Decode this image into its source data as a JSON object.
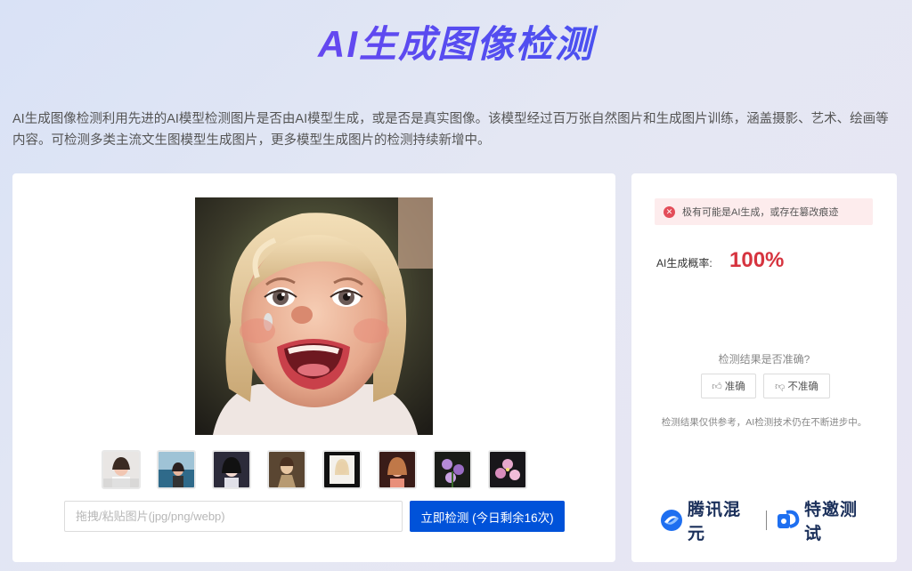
{
  "header": {
    "title": "AI生成图像检测",
    "description": "AI生成图像检测利用先进的AI模型检测图片是否由AI模型生成，或是否是真实图像。该模型经过百万张自然图片和生成图片训练，涵盖摄影、艺术、绘画等内容。可检测多类主流文生图模型生成图片，更多模型生成图片的检测持续新增中。"
  },
  "upload": {
    "placeholder": "拖拽/粘贴图片(jpg/png/webp)",
    "button_label": "立即检测 (今日剩余16次)"
  },
  "thumbnails": [
    {
      "name": "thumb-woman-portrait"
    },
    {
      "name": "thumb-woman-outdoor"
    },
    {
      "name": "thumb-anime-girl"
    },
    {
      "name": "thumb-vintage-portrait"
    },
    {
      "name": "thumb-blonde-woman"
    },
    {
      "name": "thumb-woman-warm"
    },
    {
      "name": "thumb-purple-flowers"
    },
    {
      "name": "thumb-pink-flowers"
    }
  ],
  "result": {
    "alert_text": "极有可能是AI生成，或存在篡改痕迹",
    "probability_label": "AI生成概率:",
    "probability_value": "100%",
    "feedback_question": "检测结果是否准确?",
    "accurate_label": "准确",
    "inaccurate_label": "不准确",
    "disclaimer": "检测结果仅供参考，AI检测技术仍在不断进步中。"
  },
  "branding": {
    "left": "腾讯混元",
    "right": "特邀测试"
  },
  "colors": {
    "accent": "#0052d9",
    "danger": "#d6343f",
    "title_gradient_start": "#8a3ff0",
    "title_gradient_end": "#2f5ef0"
  }
}
